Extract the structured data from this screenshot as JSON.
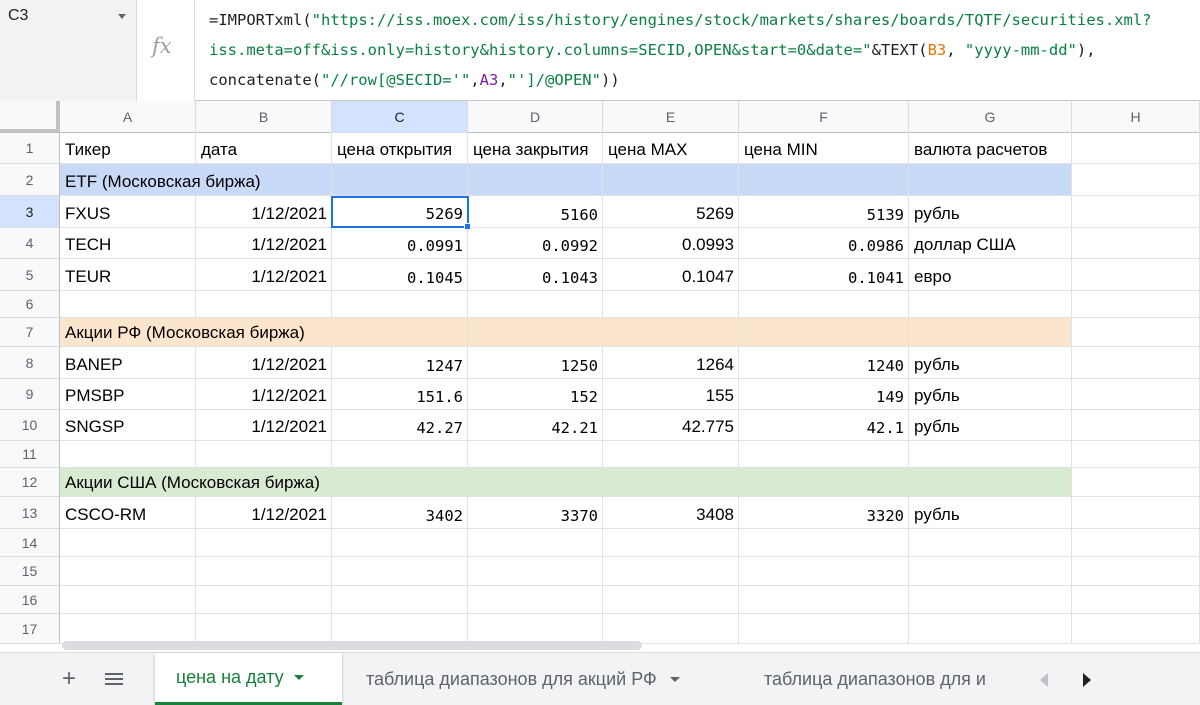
{
  "namebox": {
    "ref": "C3"
  },
  "formula_bar": {
    "fx_label": "fx",
    "line1": {
      "fn": "=IMPORTxml(",
      "str": "\"https://iss.moex.com/iss/history/engines/stock/markets/shares/boards/TQTF/securities.xml?"
    },
    "line2": {
      "str": "iss.meta=off&iss.only=history&history.columns=SECID,OPEN&start=0&date=\"",
      "mid": "&TEXT(",
      "ref": "B3",
      "sep": ", ",
      "fmt": "\"yyyy-mm-dd\"",
      "end": "),"
    },
    "line3": {
      "fn": "concatenate(",
      "str1": "\"//row[@SECID='\"",
      "c1": ",",
      "ref": "A3",
      "c2": ",",
      "str2": "\"']/@OPEN\"",
      "end": "))"
    }
  },
  "columns": [
    "A",
    "B",
    "C",
    "D",
    "E",
    "F",
    "G",
    "H"
  ],
  "row_numbers": [
    "1",
    "2",
    "3",
    "4",
    "5",
    "6",
    "7",
    "8",
    "9",
    "10",
    "11",
    "12",
    "13",
    "14",
    "15",
    "16",
    "17"
  ],
  "header_row": [
    "Тикер",
    "дата",
    "цена открытия",
    "цена закрытия",
    "цена MAX",
    "цена MIN",
    "валюта расчетов"
  ],
  "sections": {
    "etf": "ETF (Московская биржа)",
    "ru": "Акции РФ (Московская биржа)",
    "us": "Акции США (Московская биржа)"
  },
  "rows": {
    "r3": [
      "FXUS",
      "1/12/2021",
      "5269",
      "5160",
      "5269",
      "5139",
      "рубль"
    ],
    "r4": [
      "TECH",
      "1/12/2021",
      "0.0991",
      "0.0992",
      "0.0993",
      "0.0986",
      "доллар США"
    ],
    "r5": [
      "TEUR",
      "1/12/2021",
      "0.1045",
      "0.1043",
      "0.1047",
      "0.1041",
      "евро"
    ],
    "r8": [
      "BANEP",
      "1/12/2021",
      "1247",
      "1250",
      "1264",
      "1240",
      "рубль"
    ],
    "r9": [
      "PMSBP",
      "1/12/2021",
      "151.6",
      "152",
      "155",
      "149",
      "рубль"
    ],
    "r10": [
      "SNGSP",
      "1/12/2021",
      "42.27",
      "42.21",
      "42.775",
      "42.1",
      "рубль"
    ],
    "r13": [
      "CSCO-RM",
      "1/12/2021",
      "3402",
      "3370",
      "3408",
      "3320",
      "рубль"
    ]
  },
  "sheet_tabs": [
    {
      "label": "цена на дату",
      "active": true
    },
    {
      "label": "таблица диапазонов для акций РФ",
      "active": false
    },
    {
      "label": "таблица диапазонов для и",
      "active": false
    }
  ],
  "icons": {
    "add_sheet": "plus-icon",
    "all_sheets": "menu-icon",
    "prev": "chevron-left-icon",
    "next": "chevron-right-icon"
  },
  "colors": {
    "etf_band": "#c9daf8",
    "ru_band": "#fce5cd",
    "us_band": "#d9ead3",
    "selection": "#1a73e8",
    "active_tab": "#188038"
  }
}
